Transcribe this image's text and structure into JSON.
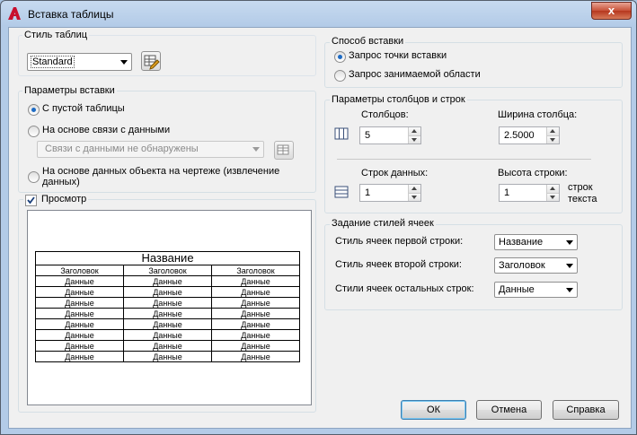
{
  "window": {
    "title": "Вставка таблицы",
    "close_glyph": "x"
  },
  "table_style": {
    "group_label": "Стиль таблиц",
    "selected": "Standard",
    "edit_button_icon": "table-style-edit-icon"
  },
  "insert_params": {
    "group_label": "Параметры вставки",
    "options": [
      "С пустой таблицы",
      "На основе связи с данными",
      "На основе данных объекта на чертеже (извлечение данных)"
    ],
    "selected_index": 0,
    "data_link_value": "Связи с данными не обнаружены"
  },
  "preview": {
    "checkbox_label": "Просмотр",
    "checked": true,
    "table_title": "Название",
    "headers": [
      "Заголовок",
      "Заголовок",
      "Заголовок"
    ],
    "row_text": "Данные",
    "row_count": 8
  },
  "insert_method": {
    "group_label": "Способ вставки",
    "options": [
      "Запрос точки вставки",
      "Запрос занимаемой области"
    ],
    "selected_index": 0
  },
  "columns_rows": {
    "group_label": "Параметры столбцов и строк",
    "columns_label": "Столбцов:",
    "columns_value": "5",
    "column_width_label": "Ширина столбца:",
    "column_width_value": "2.5000",
    "data_rows_label": "Строк данных:",
    "data_rows_value": "1",
    "row_height_label": "Высота строки:",
    "row_height_value": "1",
    "row_height_unit": "строк текста"
  },
  "cell_styles": {
    "group_label": "Задание стилей ячеек",
    "first_row_label": "Стиль ячеек первой строки:",
    "first_row_value": "Название",
    "second_row_label": "Стиль ячеек второй строки:",
    "second_row_value": "Заголовок",
    "other_rows_label": "Стили ячеек остальных строк:",
    "other_rows_value": "Данные"
  },
  "buttons": {
    "ok": "ОК",
    "cancel": "Отмена",
    "help": "Справка"
  }
}
